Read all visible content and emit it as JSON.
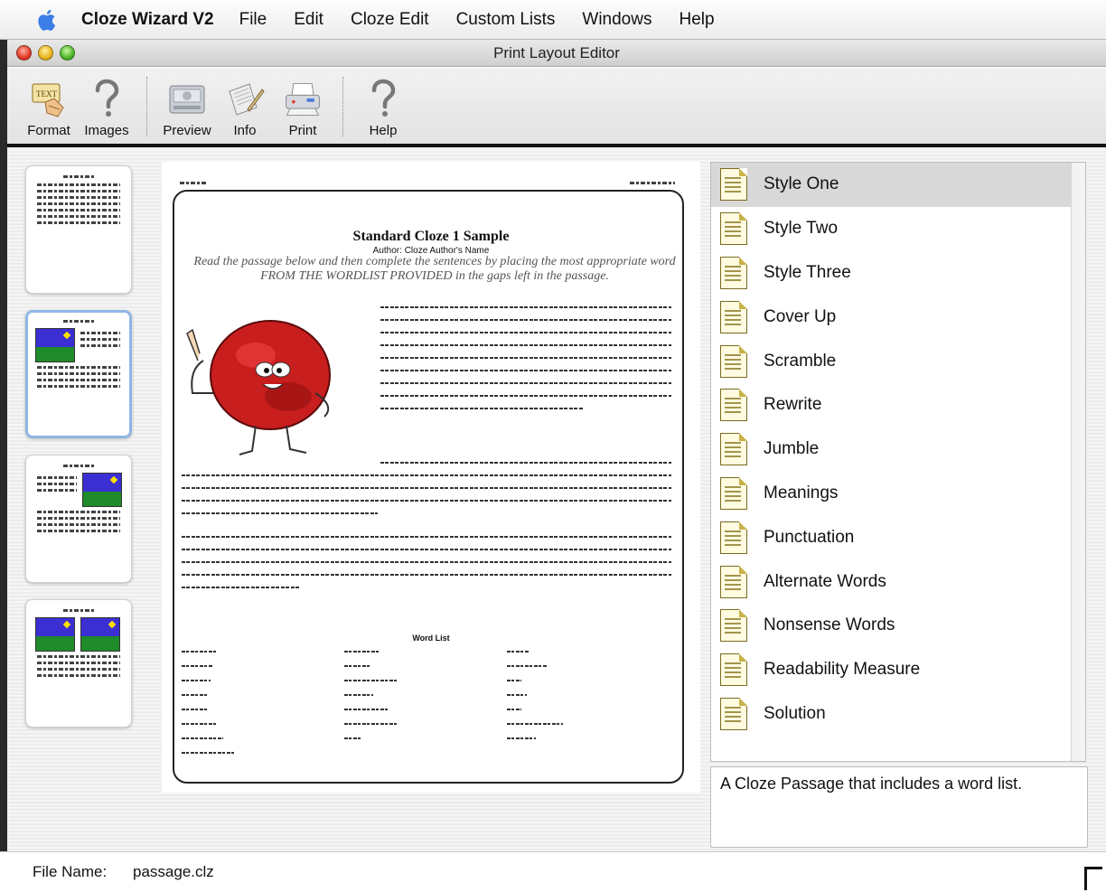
{
  "menubar": {
    "app_name": "Cloze Wizard V2",
    "items": [
      "File",
      "Edit",
      "Cloze Edit",
      "Custom Lists",
      "Windows",
      "Help"
    ]
  },
  "window": {
    "title": "Print Layout Editor"
  },
  "toolbar": {
    "format_label": "Format",
    "images_label": "Images",
    "preview_label": "Preview",
    "info_label": "Info",
    "print_label": "Print",
    "help_label": "Help"
  },
  "document": {
    "title": "Standard Cloze 1 Sample",
    "author": "Author: Cloze Author's Name",
    "instructions": "Read the passage below and then complete the sentences by placing the most appropriate word FROM THE WORDLIST PROVIDED in the gaps left in the passage.",
    "wordlist_title": "Word List"
  },
  "styles": {
    "items": [
      "Style One",
      "Style Two",
      "Style Three",
      "Cover Up",
      "Scramble",
      "Rewrite",
      "Jumble",
      "Meanings",
      "Punctuation",
      "Alternate Words",
      "Nonsense Words",
      "Readability Measure",
      "Solution"
    ],
    "selected_index": 0,
    "description": "A Cloze Passage that includes a word list."
  },
  "status": {
    "label": "File Name:",
    "value": "passage.clz"
  }
}
